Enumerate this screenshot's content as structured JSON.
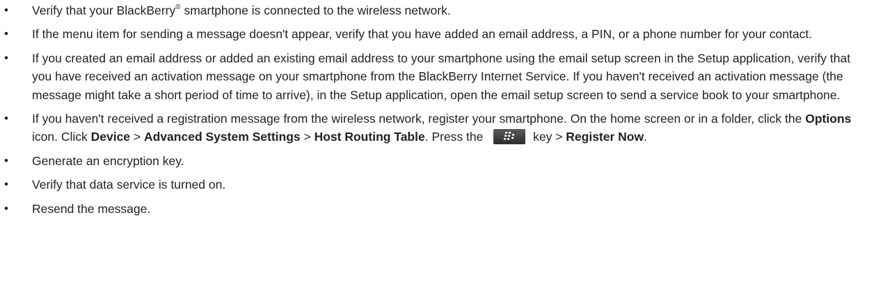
{
  "bullet": "•",
  "items": [
    {
      "a": "Verify that your BlackBerry",
      "reg": "®",
      "b": " smartphone is connected to the wireless network."
    },
    {
      "text": "If the menu item for sending a message doesn't appear, verify that you have added an email address, a PIN, or a phone number for your contact."
    },
    {
      "text": "If you created an email address or added an existing email address to your smartphone using the email setup screen in the Setup application, verify that you have received an activation message on your smartphone from the BlackBerry Internet Service. If you haven't received an activation message (the message might take a short period of time to arrive), in the Setup application, open the email setup screen to send a service book to your smartphone."
    },
    {
      "t1": "If you haven't received a registration message from the wireless network, register your smartphone. On the home screen or in a folder, click the ",
      "b1": "Options",
      "t2": " icon. Click ",
      "b2": "Device",
      "t3": " > ",
      "b3": "Advanced System Settings",
      "t4": " > ",
      "b4": "Host Routing Table",
      "t5": ". Press the ",
      "icon": "blackberry-menu-key-icon",
      "t6": " key > ",
      "b5": "Register Now",
      "t7": "."
    },
    {
      "text": "Generate an encryption key."
    },
    {
      "text": "Verify that data service is turned on."
    },
    {
      "text": "Resend the message."
    }
  ]
}
